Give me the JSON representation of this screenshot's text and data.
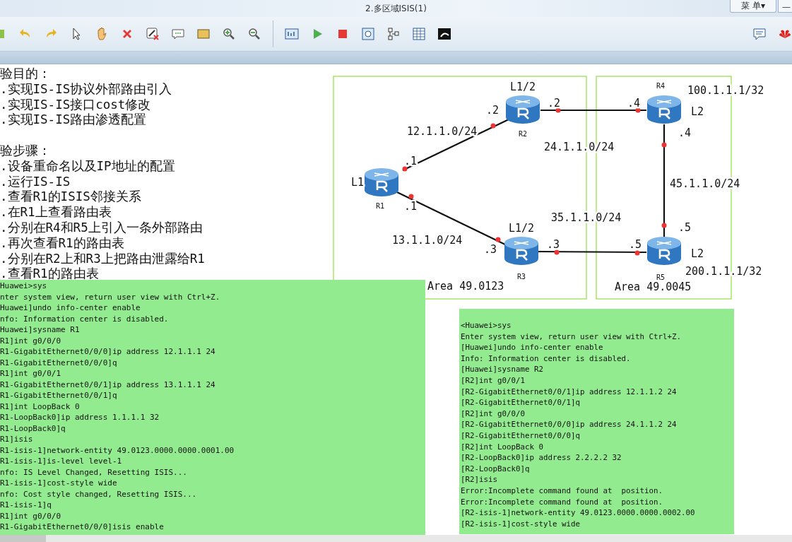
{
  "window": {
    "title": "2.多区域ISIS(1)",
    "menu_button": "菜 单▾",
    "minimize": "—"
  },
  "notes": {
    "objectives_title": "验目的：",
    "objectives": [
      ".实现IS-IS协议外部路由引入",
      ".实现IS-IS接口cost修改",
      ".实现IS-IS路由渗透配置"
    ],
    "steps_title": "验步骤：",
    "steps": [
      ".设备重命名以及IP地址的配置",
      ".运行IS-IS",
      ".查看R1的ISIS邻接关系",
      ".在R1上查看路由表",
      ".分别在R4和R5上引入一条外部路由",
      ".再次查看R1的路由表",
      ".分别在R2上和R3上把路由泄露给R1",
      ".查看R1的路由表"
    ]
  },
  "topology": {
    "areas": [
      "Area 49.0123",
      "Area 49.0045"
    ],
    "routers": [
      {
        "name": "R1",
        "level": "L1"
      },
      {
        "name": "R2",
        "level": "L1/2"
      },
      {
        "name": "R3",
        "level": "L1/2"
      },
      {
        "name": "R4",
        "level": "L2"
      },
      {
        "name": "R5",
        "level": "L2"
      }
    ],
    "links": [
      {
        "subnet": "12.1.1.0/24",
        "end_a": ".1",
        "end_b": ".2"
      },
      {
        "subnet": "13.1.1.0/24",
        "end_a": ".1",
        "end_b": ".3"
      },
      {
        "subnet": "24.1.1.0/24",
        "end_a": ".2",
        "end_b": ".4"
      },
      {
        "subnet": "35.1.1.0/24",
        "end_a": ".3",
        "end_b": ".5"
      },
      {
        "subnet": "45.1.1.0/24",
        "end_a": ".4",
        "end_b": ".5"
      }
    ],
    "external_routes": [
      "100.1.1.1/32",
      "200.1.1.1/32"
    ]
  },
  "terminals": [
    {
      "lines": [
        "Huawei>sys",
        "nter system view, return user view with Ctrl+Z.",
        "Huawei]undo info-center enable",
        "nfo: Information center is disabled.",
        "Huawei]sysname R1",
        "R1]int g0/0/0",
        "R1-GigabitEthernet0/0/0]ip address 12.1.1.1 24",
        "R1-GigabitEthernet0/0/0]q",
        "R1]int g0/0/1",
        "R1-GigabitEthernet0/0/1]ip address 13.1.1.1 24",
        "R1-GigabitEthernet0/0/1]q",
        "R1]int LoopBack 0",
        "R1-LoopBack0]ip address 1.1.1.1 32",
        "R1-LoopBack0]q",
        "R1]isis",
        "R1-isis-1]network-entity 49.0123.0000.0000.0001.00",
        "R1-isis-1]is-level level-1",
        "nfo: IS Level Changed, Resetting ISIS...",
        "R1-isis-1]cost-style wide",
        "nfo: Cost style changed, Resetting ISIS...",
        "R1-isis-1]q",
        "R1]int g0/0/0",
        "R1-GigabitEthernet0/0/0]isis enable"
      ]
    },
    {
      "lines": [
        "<Huawei>sys",
        "Enter system view, return user view with Ctrl+Z.",
        "[Huawei]undo info-center enable",
        "Info: Information center is disabled.",
        "[Huawei]sysname R2",
        "[R2]int g0/0/1",
        "[R2-GigabitEthernet0/0/1]ip address 12.1.1.2 24",
        "[R2-GigabitEthernet0/0/1]q",
        "[R2]int g0/0/0",
        "[R2-GigabitEthernet0/0/0]ip address 24.1.1.2 24",
        "[R2-GigabitEthernet0/0/0]q",
        "[R2]int LoopBack 0",
        "[R2-LoopBack0]ip address 2.2.2.2 32",
        "[R2-LoopBack0]q",
        "[R2]isis",
        "Error:Incomplete command found at  position.",
        "Error:Incomplete command found at  position.",
        "[R2-isis-1]network-entity 49.0123.0000.0000.0002.00",
        "[R2-isis-1]cost-style wide"
      ]
    }
  ]
}
